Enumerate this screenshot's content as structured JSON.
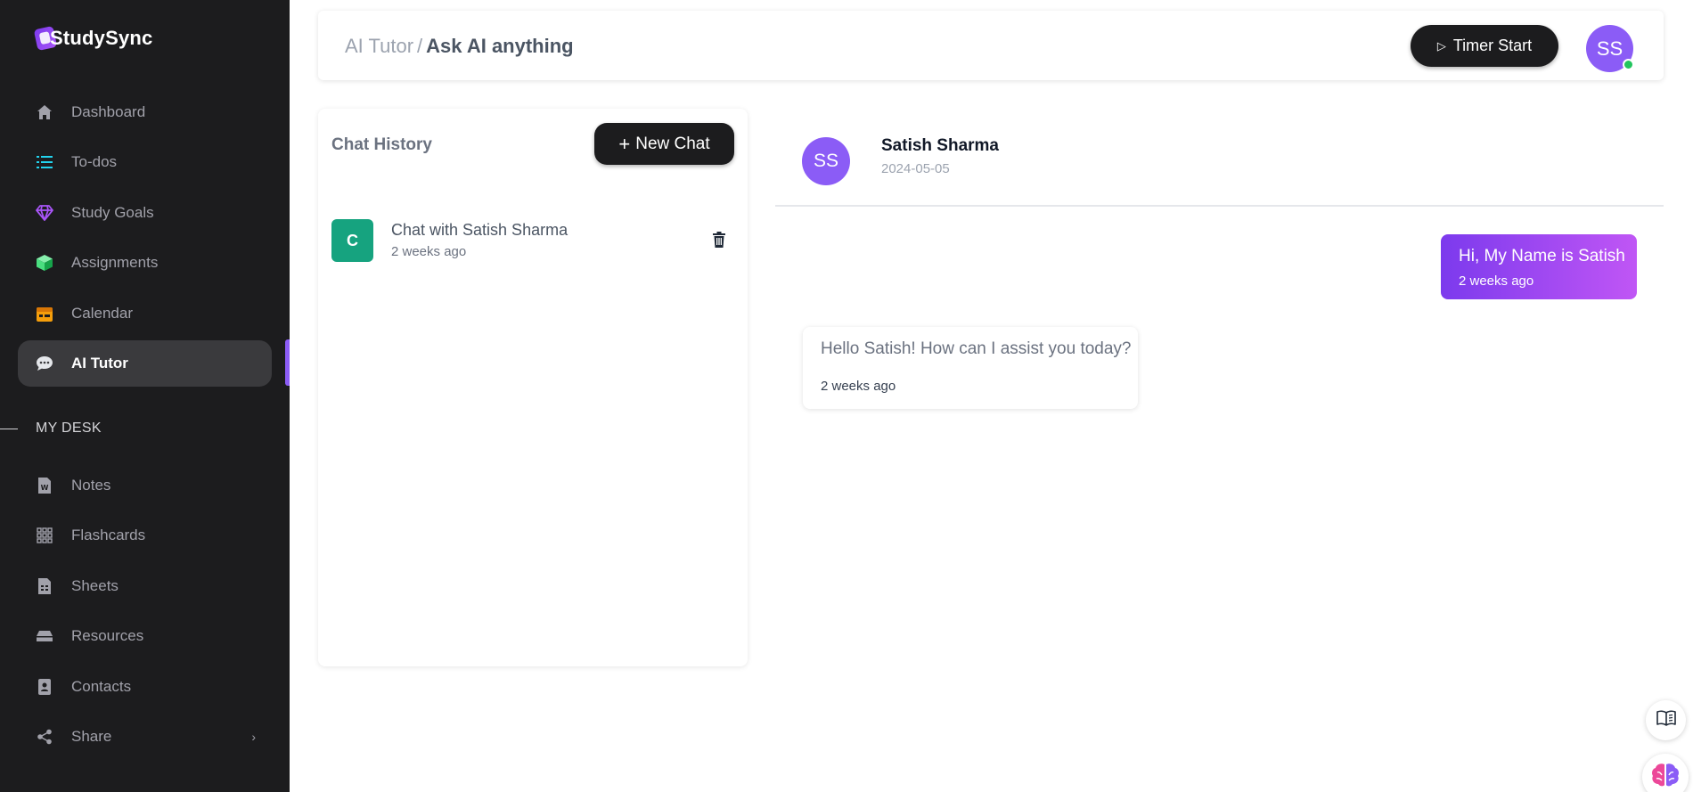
{
  "app": {
    "logo_text": "StudySync"
  },
  "sidebar": {
    "items": [
      {
        "label": "Dashboard",
        "icon": "home-icon",
        "color": "#a1a1aa"
      },
      {
        "label": "To-dos",
        "icon": "list-icon",
        "color": "#22d3ee"
      },
      {
        "label": "Study Goals",
        "icon": "diamond-icon",
        "color": "#a855f7"
      },
      {
        "label": "Assignments",
        "icon": "cube-icon",
        "color": "#4ade80"
      },
      {
        "label": "Calendar",
        "icon": "calendar-icon",
        "color": "#f59e0b"
      },
      {
        "label": "AI Tutor",
        "icon": "chat-bubble-icon",
        "color": "#e5e7eb",
        "active": true
      }
    ],
    "section_label": "MY DESK",
    "desk_items": [
      {
        "label": "Notes",
        "icon": "document-icon"
      },
      {
        "label": "Flashcards",
        "icon": "grid-icon"
      },
      {
        "label": "Sheets",
        "icon": "sheet-icon"
      },
      {
        "label": "Resources",
        "icon": "drawer-icon"
      },
      {
        "label": "Contacts",
        "icon": "contact-book-icon"
      },
      {
        "label": "Share",
        "icon": "share-icon"
      }
    ]
  },
  "header": {
    "breadcrumb_parent": "AI Tutor",
    "breadcrumb_sep": "/",
    "breadcrumb_current": "Ask AI anything",
    "timer_label": "Timer Start",
    "user_initials": "SS",
    "online_color": "#22c55e"
  },
  "history": {
    "title": "Chat History",
    "new_chat_label": "New Chat",
    "chats": [
      {
        "badge": "C",
        "title": "Chat with Satish Sharma",
        "time": "2 weeks ago"
      }
    ]
  },
  "chat": {
    "contact_initials": "SS",
    "contact_name": "Satish Sharma",
    "contact_date": "2024-05-05",
    "messages": [
      {
        "direction": "out",
        "text": "Hi, My Name is Satish",
        "time": "2 weeks ago"
      },
      {
        "direction": "in",
        "text": "Hello Satish! How can I assist you today?",
        "time": "2 weeks ago"
      }
    ]
  },
  "colors": {
    "accent": "#8b5cf6",
    "sidebar_bg": "#1c1c1e",
    "badge_green": "#16a37f"
  }
}
